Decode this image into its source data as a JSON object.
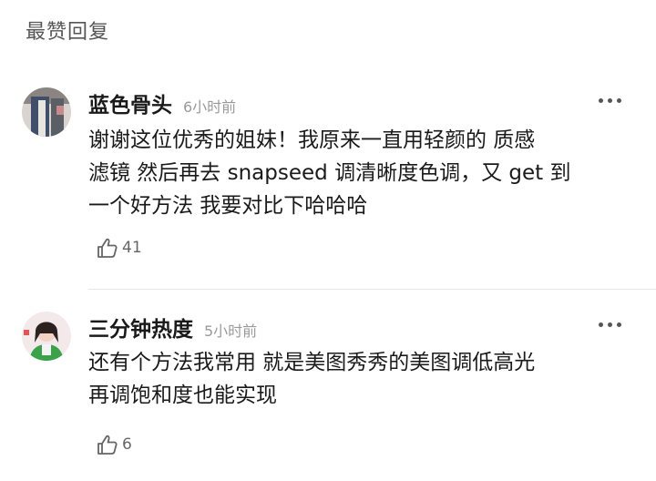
{
  "section": {
    "title": "最赞回复"
  },
  "comments": [
    {
      "username": "蓝色骨头",
      "time": "6小时前",
      "lines": [
        "谢谢这位优秀的姐妹！我原来一直用轻颜的 质感",
        "滤镜 然后再去 snapseed 调清晰度色调，又 get 到",
        "一个好方法 我要对比下哈哈哈"
      ],
      "likes": "41",
      "like_icon": "thumbs-up-icon",
      "more_icon": "more-dots-icon"
    },
    {
      "username": "三分钟热度",
      "time": "5小时前",
      "lines": [
        "还有个方法我常用 就是美图秀秀的美图调低高光",
        "再调饱和度也能实现"
      ],
      "likes": "6",
      "like_icon": "thumbs-up-icon",
      "more_icon": "more-dots-icon"
    }
  ]
}
